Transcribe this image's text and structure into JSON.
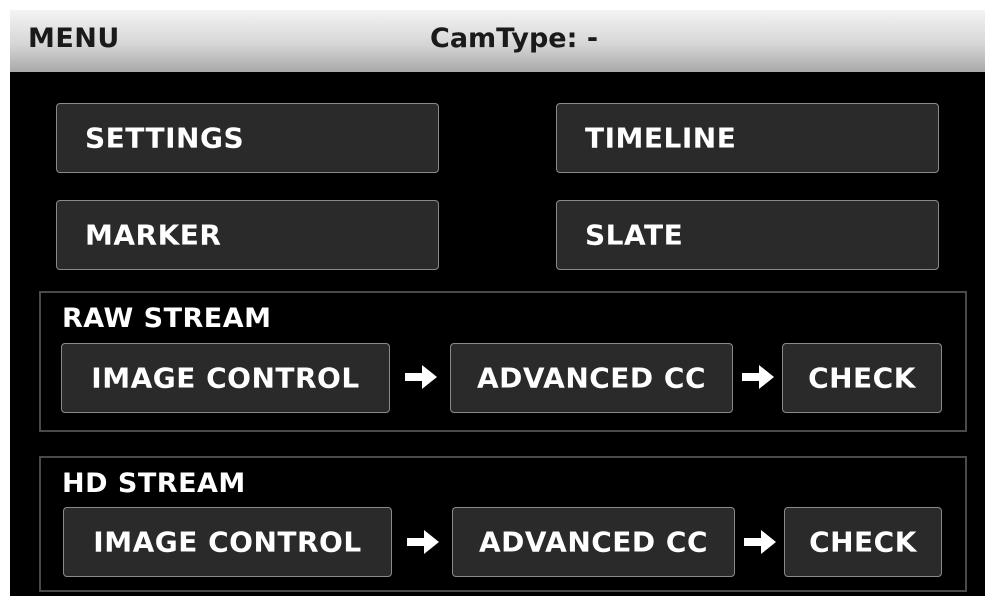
{
  "header": {
    "menu_label": "MENU",
    "cam_type": "CamType: -"
  },
  "main_buttons": {
    "settings": "SETTINGS",
    "timeline": "TIMELINE",
    "marker": "MARKER",
    "slate": "SLATE"
  },
  "raw_stream": {
    "label": "RAW STREAM",
    "image_control": "IMAGE CONTROL",
    "advanced_cc": "ADVANCED CC",
    "check": "CHECK"
  },
  "hd_stream": {
    "label": "HD STREAM",
    "image_control": "IMAGE CONTROL",
    "advanced_cc": "ADVANCED CC",
    "check": "CHECK"
  },
  "icons": {
    "flow_arrow": "right-arrow-icon"
  },
  "colors": {
    "background": "#000000",
    "button_fill": "#2a2a2a",
    "button_border": "#8a8a8a",
    "text": "#ffffff"
  }
}
